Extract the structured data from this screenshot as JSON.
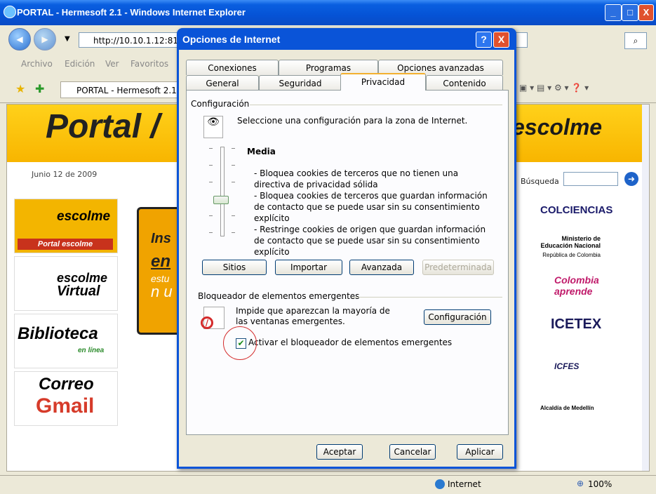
{
  "window": {
    "title": "PORTAL - Hermesoft 2.1 - Windows Internet Explorer",
    "min": "_",
    "max": "□",
    "close": "X"
  },
  "address": {
    "url": "http://10.10.1.12:81"
  },
  "menu": [
    "Archivo",
    "Edición",
    "Ver",
    "Favoritos"
  ],
  "tab": {
    "label": "PORTAL - Hermesoft 2.1"
  },
  "page": {
    "portal_text": "Portal /",
    "escolme_logo": "escolme",
    "date": "Junio 12 de 2009",
    "search_label": "Búsqueda",
    "left": {
      "escolme": "escolme",
      "portal_escolme": "Portal escolme",
      "virtual_1": "escolme",
      "virtual_2": "Virtual",
      "biblio_1": "Biblioteca",
      "biblio_2": "en línea",
      "correo": "Correo",
      "gmail": "Gmail"
    },
    "banner": {
      "line1": "Ins",
      "line2": "en",
      "line3": "estu",
      "line4": "n u"
    },
    "right_logos": [
      "COLCIENCIAS",
      "Ministerio de Educación Nacional",
      "República de Colombia",
      "Colombia aprende",
      "ICETEX",
      "ICFES",
      "Alcaldía de Medellín"
    ]
  },
  "status": {
    "zone": "Internet",
    "zoom": "100%"
  },
  "dialog": {
    "title": "Opciones de Internet",
    "help": "?",
    "close": "X",
    "tabs_back": [
      "Conexiones",
      "Programas",
      "Opciones avanzadas"
    ],
    "tabs_front": [
      "General",
      "Seguridad",
      "Privacidad",
      "Contenido"
    ],
    "config_group": "Configuración",
    "config_desc": "Seleccione una configuración para la zona de Internet.",
    "level": "Media",
    "bullets": [
      "- Bloquea cookies de terceros que no tienen una directiva de privacidad sólida",
      "- Bloquea cookies de terceros que guardan información de contacto que se puede usar sin su consentimiento explícito",
      "- Restringe cookies de origen que guardan información de contacto que se  puede usar sin su consentimiento explícito"
    ],
    "buttons_row": [
      "Sitios",
      "Importar",
      "Avanzada",
      "Predeterminada"
    ],
    "popup_group": "Bloqueador de elementos emergentes",
    "popup_desc": "Impide que aparezcan la mayoría de las ventanas emergentes.",
    "popup_config": "Configuración",
    "popup_checkbox": "Activar el bloqueador de elementos emergentes",
    "popup_checked": true,
    "footer": [
      "Aceptar",
      "Cancelar",
      "Aplicar"
    ]
  }
}
